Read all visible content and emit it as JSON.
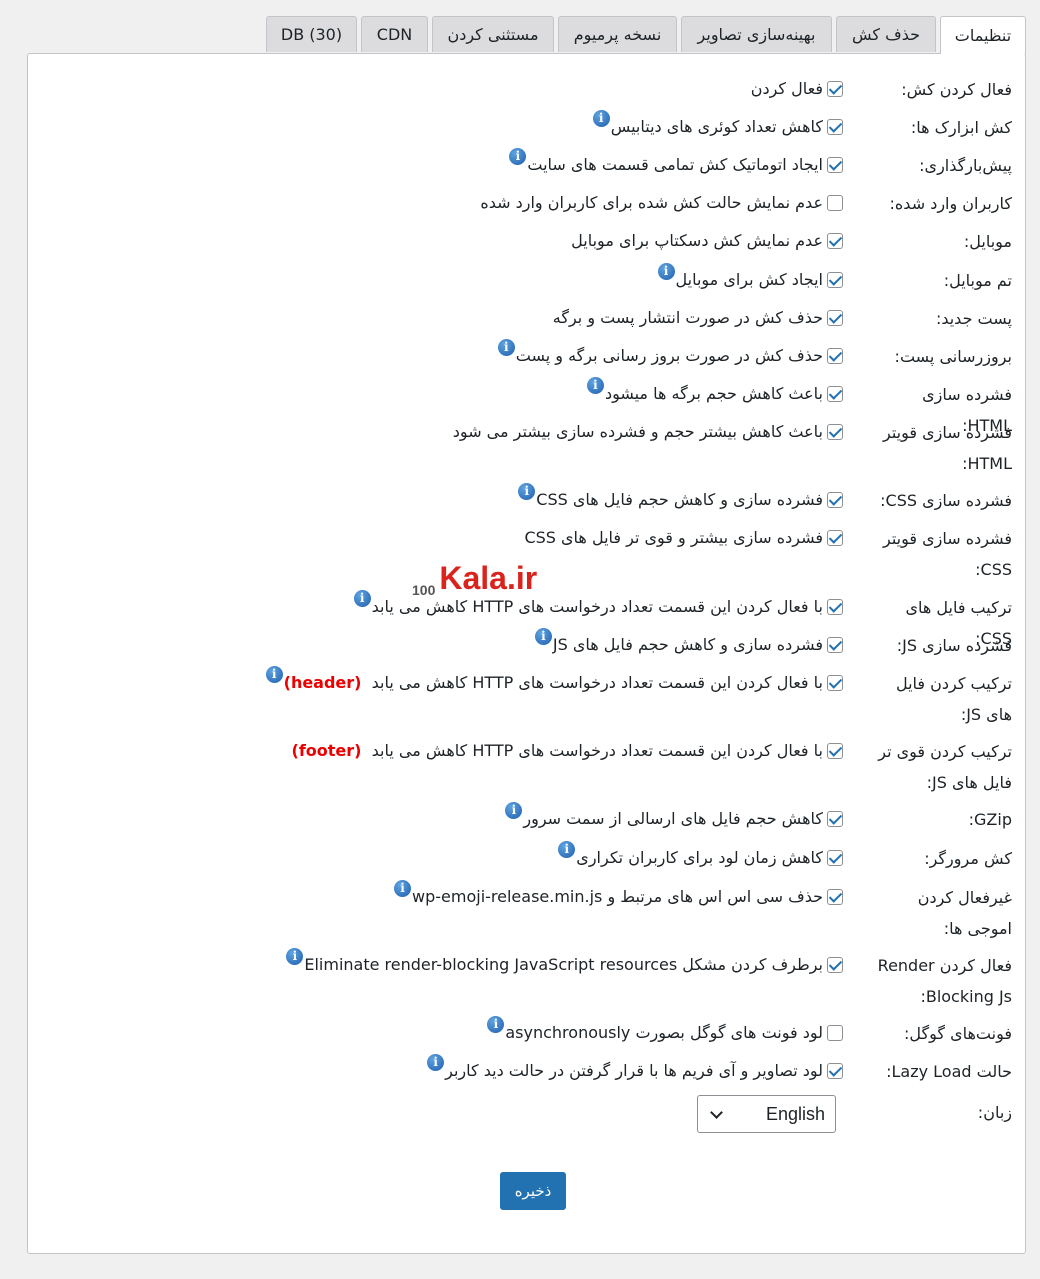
{
  "tabs": [
    "تنظیمات",
    "حذف کش",
    "بهینه‌سازی تصاویر",
    "نسخه پرمیوم",
    "مستثنی کردن",
    "CDN",
    "DB (30)"
  ],
  "rows": [
    {
      "label": "فعال کردن کش:",
      "text": "فعال کردن",
      "checked": true,
      "info": false
    },
    {
      "label": "کش ابزارک ها:",
      "text": "کاهش تعداد کوئری های دیتابیس",
      "checked": true,
      "info": true
    },
    {
      "label": "پیش‌بارگذاری:",
      "text": "ایجاد اتوماتیک کش تمامی قسمت های سایت",
      "checked": true,
      "info": true
    },
    {
      "label": "کاربران وارد شده:",
      "text": "عدم نمایش حالت کش شده برای کاربران وارد شده",
      "checked": false,
      "info": false
    },
    {
      "label": "موبایل:",
      "text": "عدم نمایش کش دسکتاپ برای موبایل",
      "checked": true,
      "info": false
    },
    {
      "label": "تم موبایل:",
      "text": "ایجاد کش برای موبایل",
      "checked": true,
      "info": true
    },
    {
      "label": "پست جدید:",
      "text": "حذف کش در صورت انتشار پست و برگه",
      "checked": true,
      "info": false
    },
    {
      "label": "بروزرسانی پست:",
      "text": "حذف کش در صورت بروز رسانی برگه و پست",
      "checked": true,
      "info": true
    },
    {
      "label": "فشرده سازی HTML:",
      "text": "باعث کاهش حجم برگه ها میشود",
      "checked": true,
      "info": true
    },
    {
      "label": "فشرده سازی قویتر HTML:",
      "text": "باعث کاهش بیشتر حجم و فشرده سازی بیشتر می شود",
      "checked": true,
      "info": false
    },
    {
      "label": "فشرده سازی CSS:",
      "text": "فشرده سازی و کاهش حجم فایل های CSS",
      "checked": true,
      "info": true
    },
    {
      "label": "فشرده سازی قویتر CSS:",
      "text": "فشرده سازی بیشتر و قوی تر فایل های CSS",
      "checked": true,
      "info": false
    },
    {
      "label": "ترکیب فایل های CSS:",
      "text": "با فعال کردن این قسمت تعداد درخواست های HTTP کاهش می یابد",
      "checked": true,
      "info": true
    },
    {
      "label": "فشرده سازی JS:",
      "text": "فشرده سازی و کاهش حجم فایل های JS",
      "checked": true,
      "info": true
    },
    {
      "label": "ترکیب کردن فایل های JS:",
      "text": "با فعال کردن این قسمت تعداد درخواست های HTTP کاهش می یابد",
      "red": "(header)",
      "checked": true,
      "info": true
    },
    {
      "label": "ترکیب کردن قوی تر فایل های JS:",
      "text": "با فعال کردن این قسمت تعداد درخواست های HTTP کاهش می یابد",
      "red": "(footer)",
      "checked": true,
      "info": false
    },
    {
      "label": "GZip:",
      "text": "کاهش حجم فایل های ارسالی از سمت سرور",
      "checked": true,
      "info": true
    },
    {
      "label": "کش مرورگر:",
      "text": "کاهش زمان لود برای کاربران تکراری",
      "checked": true,
      "info": true
    },
    {
      "label": "غیرفعال کردن اموجی ها:",
      "text": "حذف سی اس اس های مرتبط و wp-emoji-release.min.js",
      "checked": true,
      "info": true
    },
    {
      "label": "فعال کردن Render Blocking Js:",
      "text": "برطرف کردن مشکل Eliminate render-blocking JavaScript resources",
      "checked": true,
      "info": true
    },
    {
      "label": "فونت‌های گوگل:",
      "text": "لود فونت های گوگل بصورت asynchronously",
      "checked": false,
      "info": true
    },
    {
      "label": "حالت Lazy Load:",
      "text": "لود تصاویر و آی فریم ها با قرار گرفتن در حالت دید کاربر",
      "checked": true,
      "info": true
    }
  ],
  "language": {
    "label": "زبان:",
    "value": "English"
  },
  "save_label": "ذخیره",
  "watermark": {
    "text": "Kala.ir",
    "prefix": "100"
  },
  "colors": {
    "accent": "#2271b1",
    "highlight": "#ee0000"
  }
}
